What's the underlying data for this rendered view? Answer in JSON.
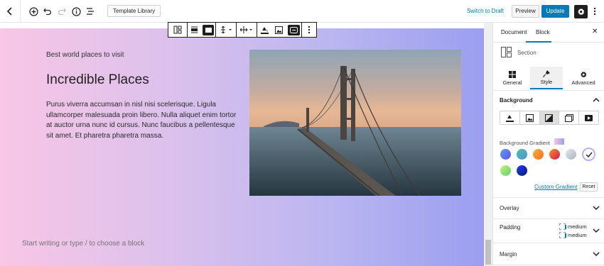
{
  "topbar": {
    "template_library": "Template Library",
    "switch_to_draft": "Switch to Draft",
    "preview": "Preview",
    "update": "Update"
  },
  "content": {
    "subtitle": "Best world places to visit",
    "title": "Incredible Places",
    "paragraph": "Purus viverra accumsan in nisl nisi scelerisque. Ligula ullamcorper malesuada proin libero. Nulla aliquet enim tortor at auctor urna nunc id cursus. Nunc faucibus a pellentesque sit amet. Et pharetra pharetra massa.",
    "placeholder": "Start writing or type / to choose a block"
  },
  "sidebar": {
    "tabs": [
      "Document",
      "Block"
    ],
    "active_tab": "Block",
    "block_name": "Section",
    "subtabs": [
      "General",
      "Style",
      "Advanced"
    ],
    "active_subtab": "Style",
    "background_title": "Background",
    "gradient_label": "Background Gradient",
    "custom_gradient": "Custom Gradient",
    "reset": "Reset",
    "overlay": "Overlay",
    "padding": "Padding",
    "padding_values": [
      "medium",
      "medium"
    ],
    "margin": "Margin"
  },
  "colors": {
    "accent": "#007cba",
    "gradient_start": "#f8c6e6",
    "gradient_end": "#9b9ef0",
    "swatches": [
      "#6b63f0",
      "#4fb7a0",
      "#f7941d",
      "#e8502a",
      "#cfd5dc",
      "#d8c8f2",
      "#8ee08a",
      "#1a3bc8"
    ]
  }
}
